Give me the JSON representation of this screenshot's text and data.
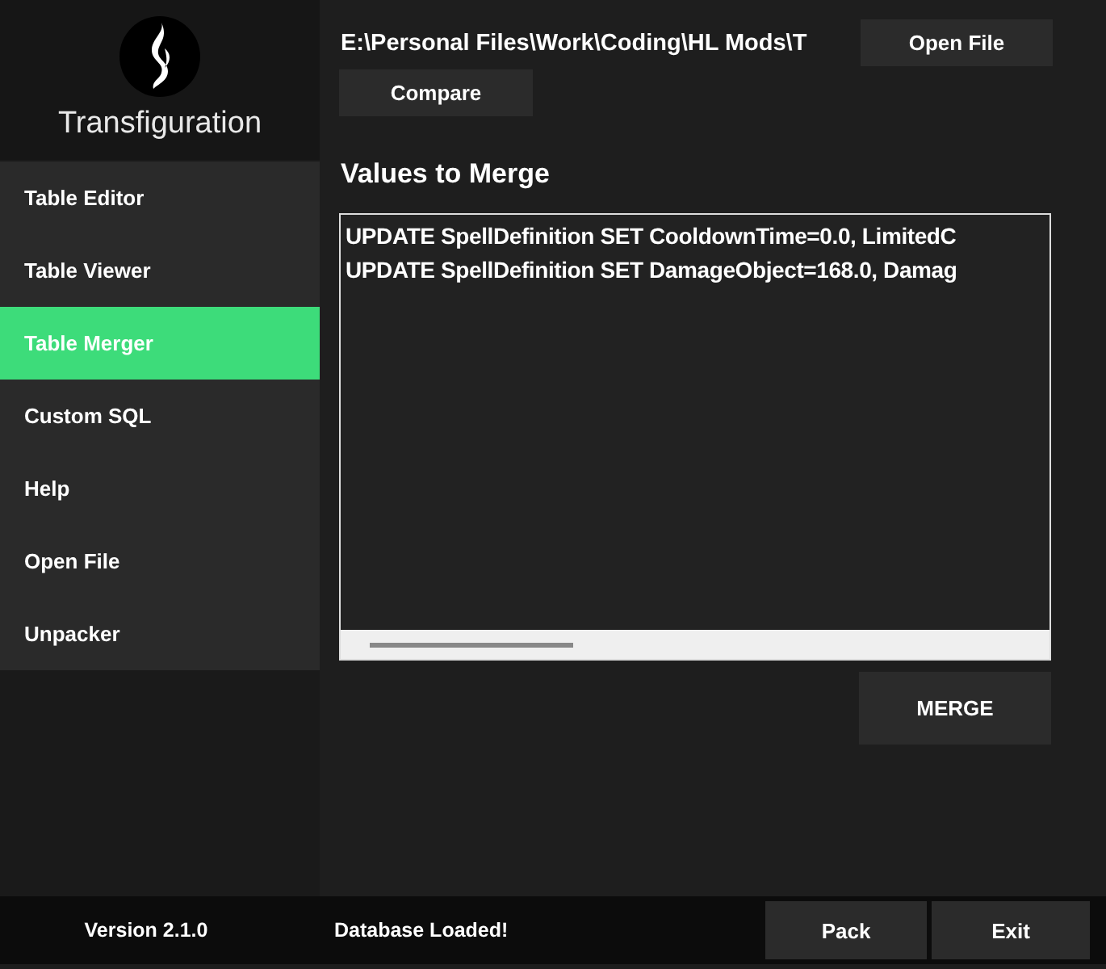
{
  "app": {
    "title": "Transfiguration"
  },
  "sidebar": {
    "items": [
      {
        "label": "Table Editor",
        "selected": false
      },
      {
        "label": "Table Viewer",
        "selected": false
      },
      {
        "label": "Table Merger",
        "selected": true
      },
      {
        "label": "Custom SQL",
        "selected": false
      },
      {
        "label": "Help",
        "selected": false
      },
      {
        "label": "Open File",
        "selected": false
      },
      {
        "label": "Unpacker",
        "selected": false
      }
    ]
  },
  "file_path": "E:\\Personal Files\\Work\\Coding\\HL Mods\\T",
  "open_file_button": "Open File",
  "compare_button": "Compare",
  "merge_section": {
    "title": "Values to Merge",
    "lines": [
      "UPDATE SpellDefinition SET CooldownTime=0.0, LimitedC",
      "UPDATE SpellDefinition SET DamageObject=168.0, Damag"
    ],
    "merge_button": "MERGE"
  },
  "status_bar": {
    "version": "Version 2.1.0",
    "status": "Database Loaded!",
    "buttons": [
      "Pack",
      "Exit"
    ]
  }
}
